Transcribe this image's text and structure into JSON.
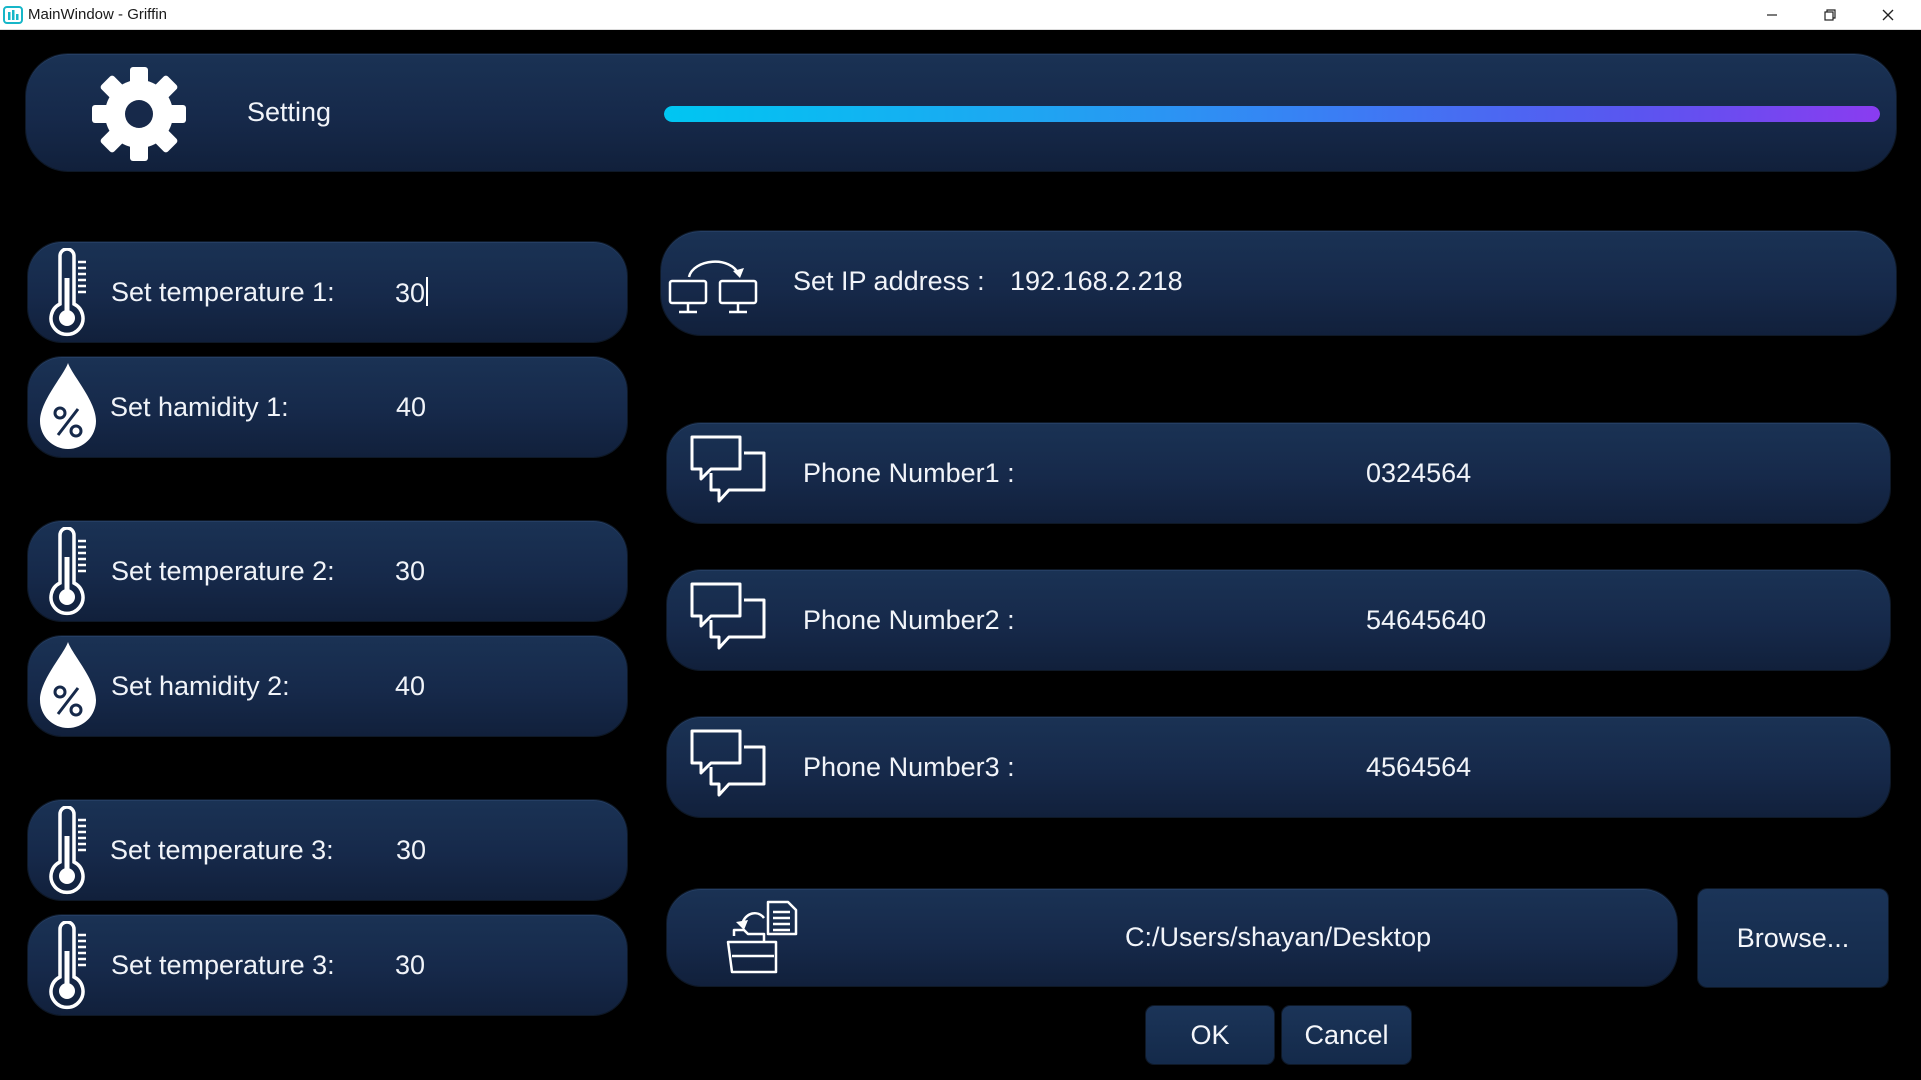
{
  "window": {
    "title": "MainWindow - Griffin",
    "controls": {
      "minimize": "minimize-icon",
      "maximize": "restore-icon",
      "close": "close-icon"
    }
  },
  "header": {
    "icon": "gear-icon",
    "title": "Setting",
    "progress": 1.0,
    "progress_colors": [
      "#00c6f2",
      "#8a3cf0"
    ]
  },
  "sensors": [
    {
      "label": "Set temperature 1:",
      "value": "30",
      "icon": "thermometer-icon"
    },
    {
      "label": "Set hamidity 1:",
      "value": "40",
      "icon": "humidity-drop-icon"
    },
    {
      "label": "Set temperature 2:",
      "value": "30",
      "icon": "thermometer-icon"
    },
    {
      "label": "Set hamidity 2:",
      "value": "40",
      "icon": "humidity-drop-icon"
    },
    {
      "label": "Set temperature 3:",
      "value": "30",
      "icon": "thermometer-icon"
    },
    {
      "label": "Set temperature 3:",
      "value": "30",
      "icon": "thermometer-icon"
    }
  ],
  "network": {
    "label": "Set IP address :",
    "value": "192.168.2.218",
    "icon": "network-sync-icon"
  },
  "phones": [
    {
      "label": "Phone Number1 :",
      "value": "0324564",
      "icon": "chat-bubbles-icon"
    },
    {
      "label": "Phone Number2 :",
      "value": "54645640",
      "icon": "chat-bubbles-icon"
    },
    {
      "label": "Phone Number3 :",
      "value": "4564564",
      "icon": "chat-bubbles-icon"
    }
  ],
  "path": {
    "value": "C:/Users/shayan/Desktop",
    "icon": "folder-document-icon",
    "browse_label": "Browse..."
  },
  "actions": {
    "ok_label": "OK",
    "cancel_label": "Cancel"
  },
  "colors": {
    "background": "#000000",
    "card": "#16294a",
    "text": "#f1f4f9"
  }
}
